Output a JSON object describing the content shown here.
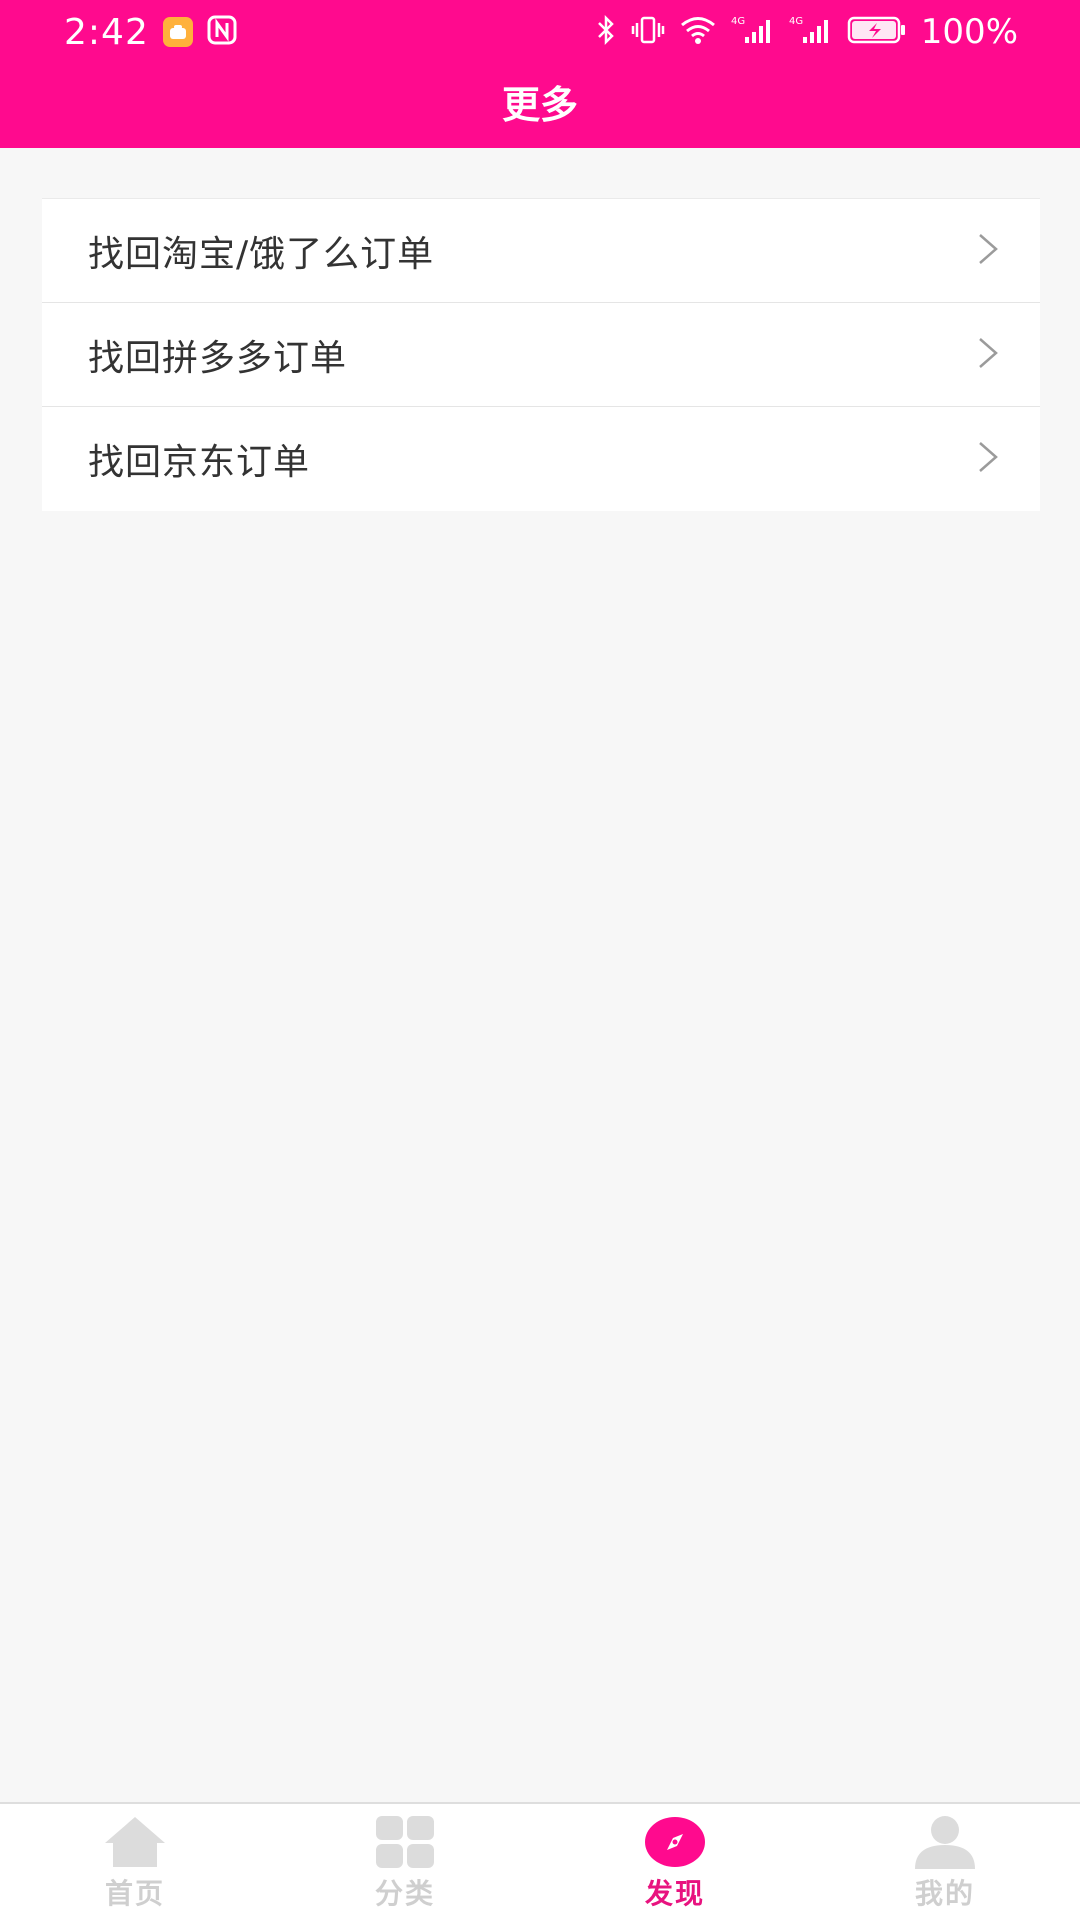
{
  "status_bar": {
    "time": "2:42",
    "battery": "100%",
    "network_label": "4G"
  },
  "header": {
    "title": "更多"
  },
  "menu": {
    "items": [
      {
        "label": "找回淘宝/饿了么订单"
      },
      {
        "label": "找回拼多多订单"
      },
      {
        "label": "找回京东订单"
      }
    ]
  },
  "tabbar": {
    "tabs": [
      {
        "label": "首页",
        "icon": "home-icon",
        "active": false
      },
      {
        "label": "分类",
        "icon": "category-grid-icon",
        "active": false
      },
      {
        "label": "发现",
        "icon": "compass-icon",
        "active": true
      },
      {
        "label": "我的",
        "icon": "person-icon",
        "active": false
      }
    ]
  },
  "colors": {
    "brand": "#ff0a8e",
    "active_tab": "#e8137f",
    "inactive_tab": "#cfcfcf",
    "background": "#f7f7f7"
  }
}
